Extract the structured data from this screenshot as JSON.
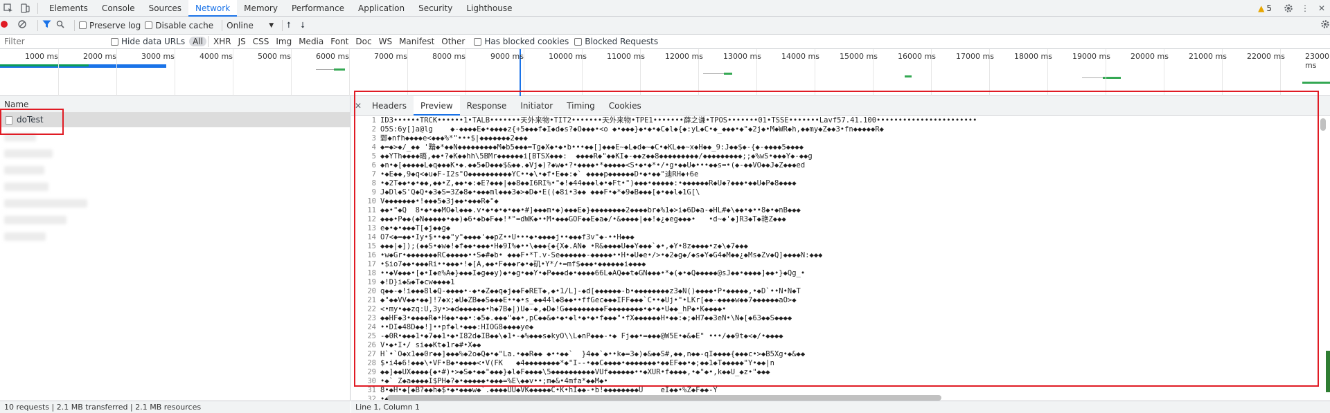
{
  "tabs": [
    "Elements",
    "Console",
    "Sources",
    "Network",
    "Memory",
    "Performance",
    "Application",
    "Security",
    "Lighthouse"
  ],
  "warnings_count": "5",
  "toolbar": {
    "preserve_log": "Preserve log",
    "disable_cache": "Disable cache",
    "throttle": "Online"
  },
  "filter": {
    "placeholder": "Filter",
    "hide_data_urls": "Hide data URLs",
    "types": [
      "All",
      "XHR",
      "JS",
      "CSS",
      "Img",
      "Media",
      "Font",
      "Doc",
      "WS",
      "Manifest",
      "Other"
    ],
    "has_blocked_cookies": "Has blocked cookies",
    "blocked_requests": "Blocked Requests"
  },
  "timeline_ticks": [
    "1000 ms",
    "2000 ms",
    "3000 ms",
    "4000 ms",
    "5000 ms",
    "6000 ms",
    "7000 ms",
    "8000 ms",
    "9000 ms",
    "10000 ms",
    "11000 ms",
    "12000 ms",
    "13000 ms",
    "14000 ms",
    "15000 ms",
    "16000 ms",
    "17000 ms",
    "18000 ms",
    "19000 ms",
    "20000 ms",
    "21000 ms",
    "22000 ms",
    "23000 ms"
  ],
  "request_list": {
    "header": "Name",
    "selected": "doTest"
  },
  "status": {
    "left": "10 requests  |  2.1 MB transferred  |  2.1 MB resources",
    "right": "Line 1, Column 1"
  },
  "detail_tabs": [
    "Headers",
    "Preview",
    "Response",
    "Initiator",
    "Timing",
    "Cookies"
  ],
  "preview_lines": [
    "ID3••••••TRCK••••••1•TALB•••••••天外来物•TIT2•••••••天外来物•TPE1•••••••薛之谦•TPOS•••••••01•TSSE•••••••Lavf57.41.100•••••••••••••••••••••••",
    "O5S:6y[]a@lg    ◆-◆◆◆◆E◆•◆◆◆◆z{+5◆◆◆f◆I◆d◆s?◆O◆◆◆•<o ◆•◆◆◆}◆•◆•◆C◆l◆{◆:yL◆C•◆_◆◆◆•◆\"◆2j◆•M◆WR◆h,◆◆my◆Z◆◆3•fn◆◆◆◆◆R◆",
    "鄄◆nfh◆◆◆◆e<◆◆◆%*\"•••$|◆◆◆◆◆◆◆2◆◆◆",
    "◆=◆>◆/_◆◆ '黯◆*◆◆N◆◆◆◆◆◆◆◆◆M◆b5◆◆◆=Tg◆X◆•◆•b•••◆◆[]◆◆◆E~◆L◆d◆~◆C•◆KL◆◆~x◆H◆◆_9:J◆◆$◆-{◆-◆◆◆◆5◆◆◆◆",
    "◆◆YTh◆◆◆◆晤,◆◆•?◆K◆◆hh\\5BMr◆◆◆◆◆◆i[BTSX◆◆◆:  ◆◆◆◆R◆\"◆◆KI◆-◆◆z◆◆8◆◆◆◆◆◆◆◆◆/◆◆◆◆◆◆◆◆◆;;◆%wS•◆◆◆Y◆-◆◆g",
    "◆n•◆[◆◆◆◆◆L◆q◆◆◆K•◆.◆◆5◆D◆◆◆$&◆◆.◆Vj◆)?◆w◆•?•◆◆◆◆•*◆◆◆◆◆<S•◆•◆*•/•g•◆◆U◆•••◆◆s=•(◆-◆◆VO◆◆J◆Z◆◆◆ed",
    "•◆E◆◆,9◆q<◆u◆F-I2s\"O◆◆◆◆◆◆◆◆◆◆YC••◆\\•◆f•E◆◆:◆` ◆◆◆◆p◆◆◆◆◆◆D•◆•◆◆\"迪RH◆+6e",
    "•◆2T◆◆•◆•◆◆,◆◆•Z,◆◆•◆:◆E?◆◆◆|◆◆8◆◆I6RI%•\"◆!◆44◆◆◆l◆•◆Ft•\")◆◆◆•◆◆◆◆◆:•◆◆◆◆◆◆R◆U◆?◆◆◆•◆◆U◆P◆8◆◆◆◆",
    "J◆Dl◆S'Q◆Q•◆3◆S=3Z◆8◆•◆◆◆ml◆◆◆3◆>◆D◆•E((◆8i•3◆◆ ◆◆◆F•◆*◆9◆B◆◆◆[◆•◆◆l◆1G[\\",
    "V◆◆◆◆◆◆◆•!◆◆◆5◆3j◆◆•◆◆◆R◆\"◆",
    "◆◆•\"◆Q  8•◆•◆◆MO◆l◆◆◆.v•◆•◆•◆•◆◆•#]◆◆◆m•◆)◆◆◆E◆}◆◆◆◆◆◆◆◆2◆◆◆◆br◆%1◆>i◆6D◆a-◆HL#◆\\◆◆•◆••8◆•◆nB◆◆◆",
    "◆◆◆•P◆◆(◆N◆◆◆◆◆•◆◆)◆6•◆b◆F◆◆!*\"=dWK◆••M•◆◆◆GOF◆◆E◆a◆/•&◆◆◆◆|◆◆!◆¿◆eg◆◆◆•   •d~◆'◆]R3◆T◆艳Z◆◆◆",
    "e◆•◆•◆◆◆T[◆j◆◆g◆",
    "O7<◆=◆◆•Iy•$••◆◆\"y\"◆◆◆◆'◆◆pZ••U•••◆•◆◆◆◆j••◆◆◆f3v\"◆-••H◆◆◆",
    "◆◆◆|◆]);(◆◆S•◆w◆!◆f◆◆•◆◆◆•H◆9I%◆••\\◆◆◆{◆{X◆.AN◆ •R&◆◆◆◆U◆◆Y◆◆◆`◆•,◆Y•8z◆◆◆◆•z◆\\◆7◆◆◆",
    "•w◆Gr•◆◆◆◆◆◆◆RC◆◆◆◆◆••S◆#◆b• ◆◆◆F•*T.v-Se◆◆◆◆◆◆-◆◆◆◆◆••H•◆U◆e•/>•◆2◆g◆/◆s◆Y◆G4◆M◆◆¿◆Ms◆Zv◆Q]◆◆◆◆N:◆◆◆",
    "•$io7◆◆•◆◆◆Ri••◆◆◆•!◆[A,◆◆•F◆◆◆r◆•◆矶•Y*/•=mf$◆◆◆•◆◆◆◆◆◆i◆◆◆◆",
    "••◆V◆◆◆•[◆•I◆e%A◆}◆◆◆I◆g◆◆y)◆•◆g•◆◆Y•◆P◆◆◆d◆•◆◆◆◆66L◆AQ◆◆t◆GN◆◆◆•*◆(◆•◆Q◆◆◆◆◆@sJ◆◆•◆◆◆◆]◆◆•}◆Qg_•",
    "◆!D}i◆&◆T◆cw◆◆◆◆1",
    "q◆◆-◆!i◆◆◆8l◆Q-◆◆◆◆•-◆•◆Z◆◆q◆j◆◆F◆RET◆,◆•1/L]-◆d[◆◆◆◆◆◆-b•◆◆◆◆◆◆◆◆z3◆N()◆◆◆◆•P•◆◆◆◆◆,•◆D`••N•N◆T",
    "◆\"◆◆VV◆◆•◆◆]!7◆x;◆U◆ZB◆◆S◆◆◆E••◆•s_◆◆44l◆8◆◆••ffGec◆◆◆IFF◆◆◆`C••◆Uj•\"•LKr[◆◆-◆◆◆◆w◆◆7◆◆◆◆◆◆aO>◆",
    "<•my•◆◆zq:U,3y•>◆d◆◆◆◆◆◆•h◆7B◆|)U◆-◆,◆D◆!G◆◆◆◆◆◆◆◆◆F◆◆◆◆◆◆◆◆•◆•◆•U◆◆_hP◆•K◆◆◆◆•",
    "◆◆HF◆3•◆◆◆◆R◆•H◆◆•◆◆•:◆5◆.◆◆◆\"◆◆•,pC◆◆&◆•◆•◆l•◆•◆•f◆◆◆\"•fX◆◆◆◆◆◆H•◆◆:◆;◆H7◆◆3eN•\\N◆[◆63◆◆S◆◆◆◆",
    "••DI◆48D◆◆!]••pf◆l•◆◆◆:HIOG8◆◆◆◆ye◆",
    "-◆0R•◆◆◆1•◆7◆◆1•◆•I82d◆IB◆◆\\◆1•-◆%◆◆◆s◆kyO\\\\L◆nP◆◆◆-•◆ Fj◆◆•=◆◆◆@W5E•◆&◆E\" •••/◆◆9t◆<◆/•◆◆◆◆",
    "V•◆•I•/ si◆◆Kt◆1r◆#•X◆◆",
    "H`•`O◆x1◆◆0r◆◆]◆◆◆%◆2o◆Q◆•◆\"La.•◆◆R◆◆ ◆••◆◆`  }4◆◆`◆••k◆=3◆)◆&◆◆S#,◆◆,n◆◆-qI◆◆◆◆{◆◆◆c•>◆B5Xg•◆&◆◆",
    "$•i4◆6!◆◆◆\\•VF•B◆•◆◆◆◆<•V(FK   ◆4◆◆◆◆◆◆◆◆*◆\"I--•◆◆C◆◆◆◆•◆◆◆◆◆◆◆•◆◆EF◆◆•◆;◆◆1◆T◆◆◆◆◆\"Y•◆◆|n",
    "◆◆]◆◆UX◆◆◆◆{◆•#)•>◆S◆•◆◆\"◆◆◆}◆l◆F◆◆◆◆\\5◆◆◆◆◆◆◆◆◆◆VUf◆◆◆◆◆◆••◆XUR•f◆◆◆◆,•◆\"◆•,k◆◆U_◆z•\"◆◆◆",
    "•◆` Z◆a◆◆◆◆I$PH◆?◆•◆◆◆◆◆•◆◆◆=%E\\◆◆v••;m◆&•4mfa*◆◆M◆•",
    "8•◆H•◆[◆B?◆◆h◆$•◆•◆◆◆w◆`.◆◆◆◆UU◆VK◆◆◆◆◆C•K•hI◆◆-•b!◆◆◆◆◆◆◆◆U    eI◆◆•%Z◆F◆◆-Y",
    "•◆v◆#",
    ""
  ]
}
